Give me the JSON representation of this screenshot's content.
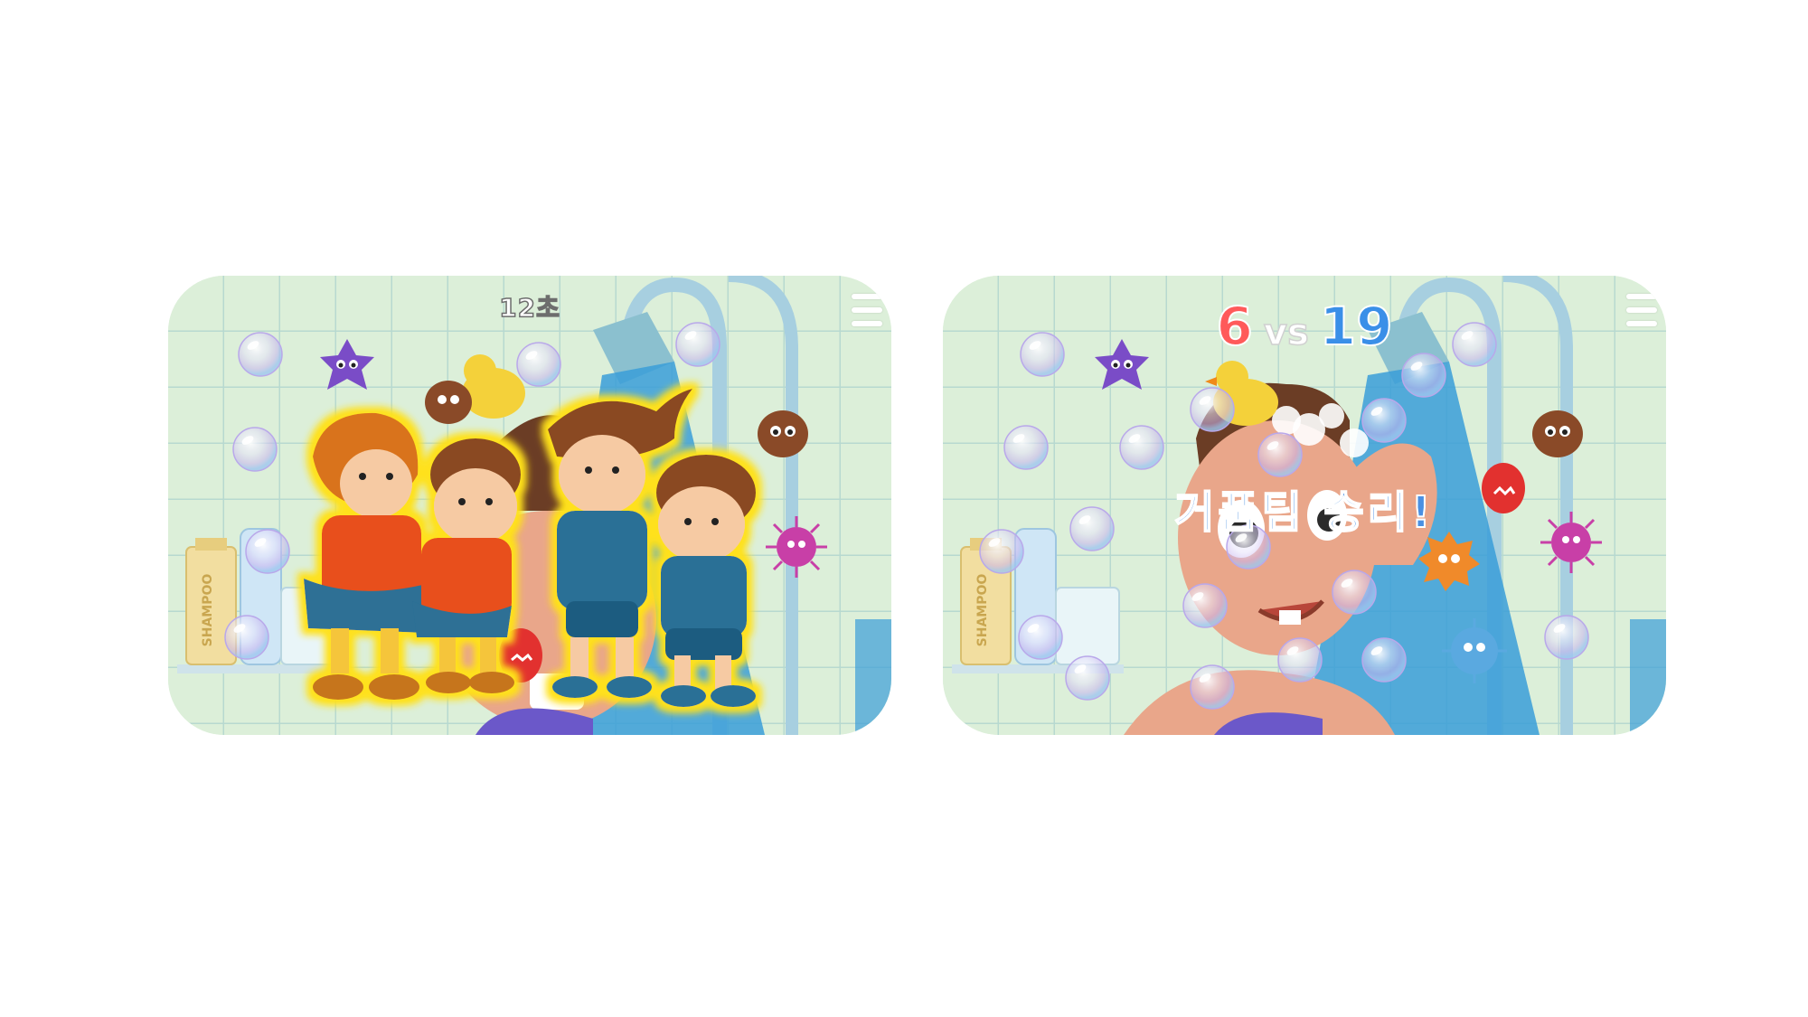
{
  "left_screen": {
    "timer": "12초",
    "menu_icon": "hamburger-menu-icon"
  },
  "right_screen": {
    "score": {
      "left": "6",
      "vs": "vs",
      "right": "19"
    },
    "result_text": "거품팀 승리!",
    "menu_icon": "hamburger-menu-icon"
  },
  "bottle_label": "SHAMPOO",
  "colors": {
    "background": "#ffffff",
    "wall": "#dcefd9",
    "tile_line": "#b7d9d0",
    "score_red": "#ff5a5a",
    "score_blue": "#3a8fe8",
    "result_text": "#4a90e2",
    "team_orange": "#e8501a",
    "team_blue": "#2a6f96",
    "glow": "#ffe11a"
  }
}
